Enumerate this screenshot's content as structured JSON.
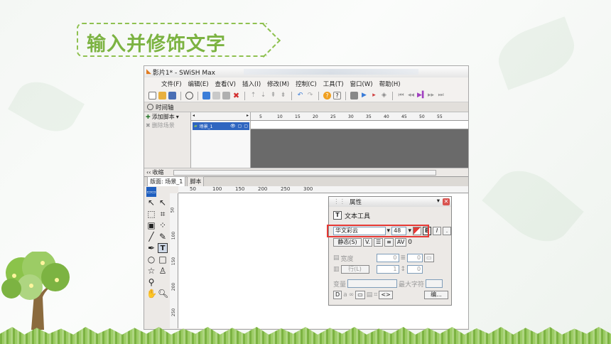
{
  "slide": {
    "title": "输入并修饰文字"
  },
  "app": {
    "window_title": "影片1* - SWiSH Max",
    "menu": [
      "文件(F)",
      "编辑(E)",
      "查看(V)",
      "插入(I)",
      "修改(M)",
      "控制(C)",
      "工具(T)",
      "窗口(W)",
      "帮助(H)"
    ],
    "timeline_tab": "时间轴",
    "add_script": "添加脚本",
    "delete_scene": "删除场景",
    "scene_item": "场景_1",
    "collapse": "收缩",
    "ruler_numbers": [
      "5",
      "10",
      "15",
      "20",
      "25",
      "30",
      "35",
      "40",
      "45",
      "50",
      "55"
    ],
    "stage_tabs": [
      "版面: 场景_1",
      "脚本"
    ],
    "stage_ruler_h": [
      "50",
      "100",
      "150",
      "200",
      "250",
      "300"
    ],
    "stage_ruler_v": [
      "50",
      "100",
      "150",
      "200",
      "250"
    ]
  },
  "properties": {
    "title": "属性",
    "tool_name": "文本工具",
    "font": "华文彩云",
    "size": "48",
    "bold": "B",
    "italic": "I",
    "static_label": "静态(S)",
    "spacing_value": "0",
    "width_label": "宽度",
    "width_value": "0",
    "height_value": "0",
    "line_label": "行(L)",
    "line_value": "1",
    "line_right_value": "0",
    "variable_label": "变量",
    "max_chars_label": "最大字符",
    "edit_btn": "编..."
  }
}
